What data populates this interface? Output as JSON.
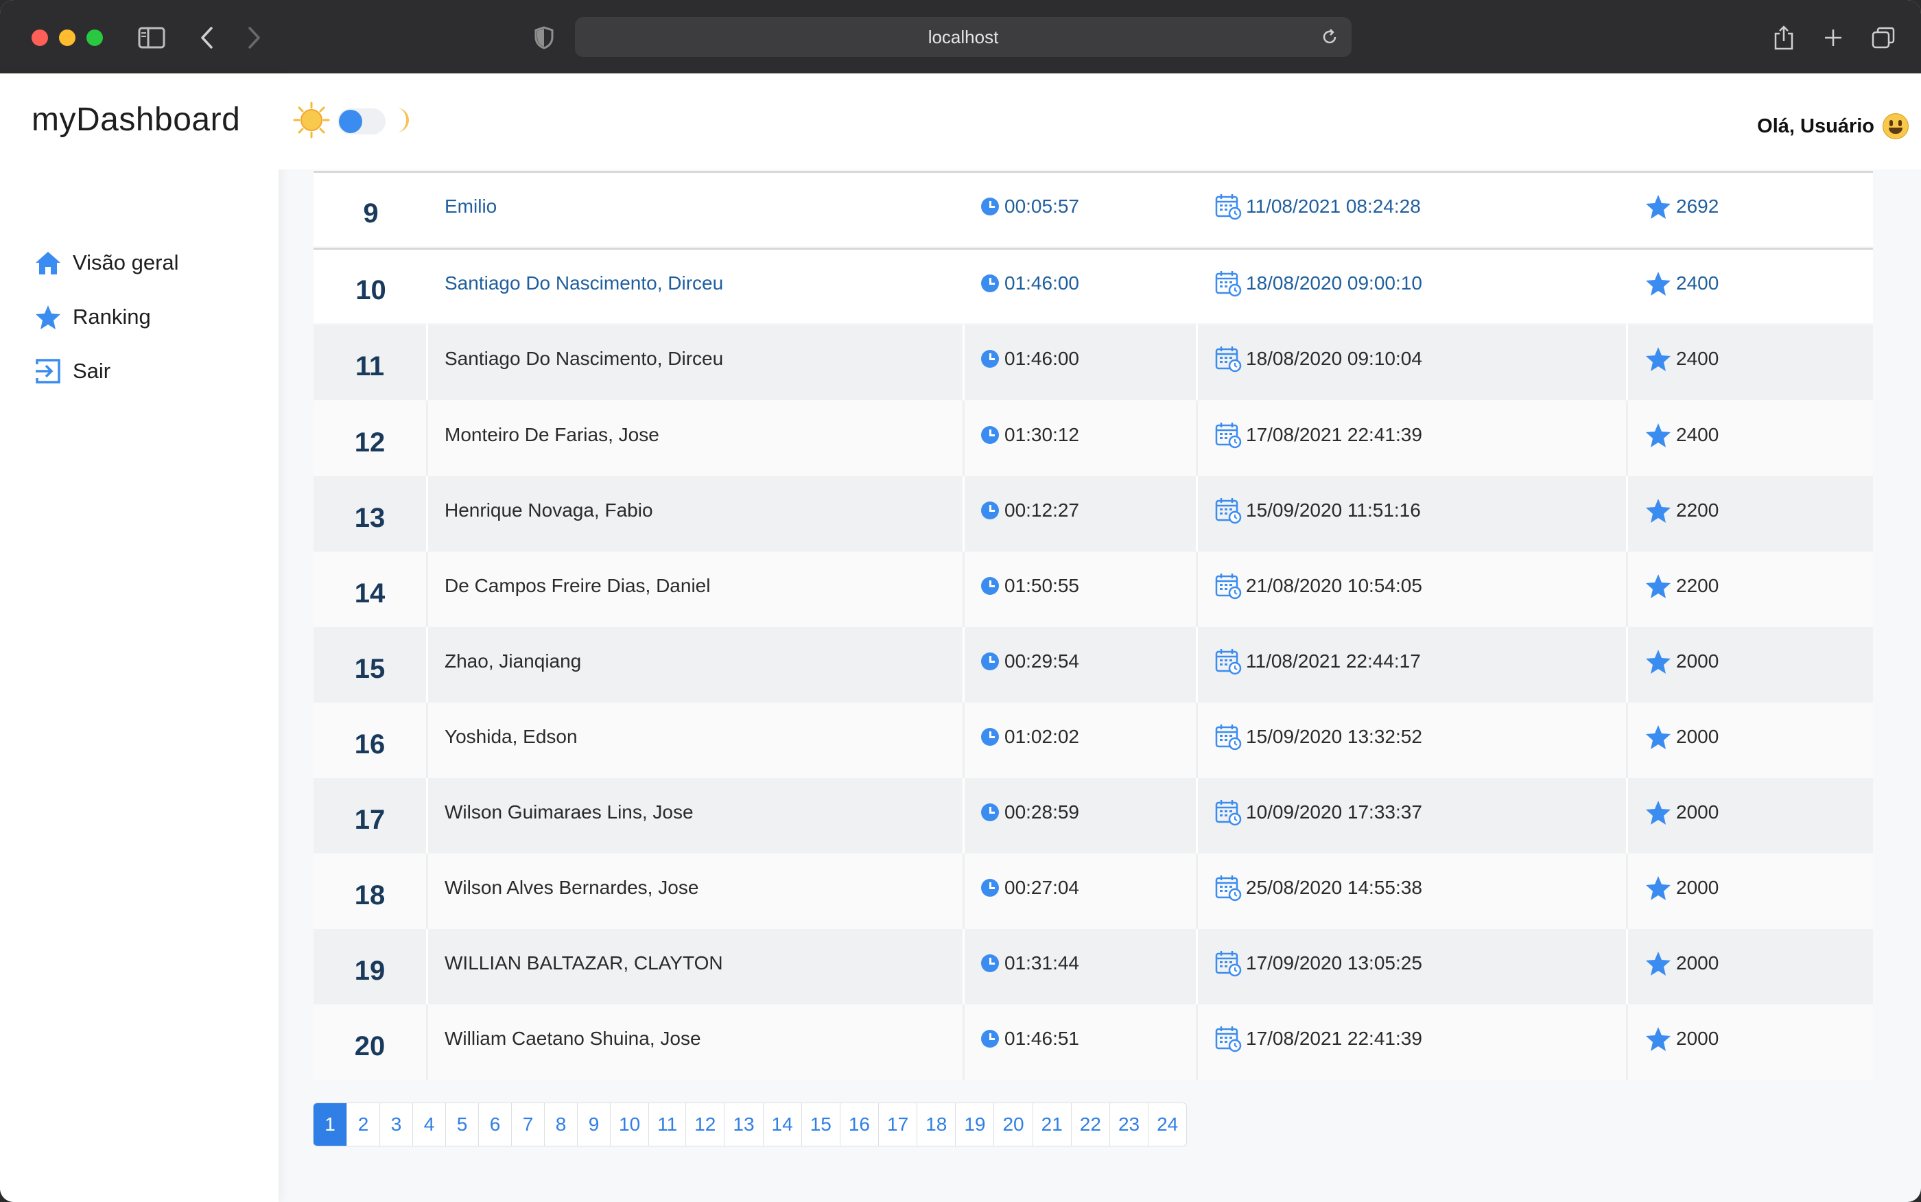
{
  "browser": {
    "url": "localhost"
  },
  "sidebar": {
    "brand": "myDashboard",
    "items": [
      {
        "label": "Visão geral",
        "icon": "home-icon"
      },
      {
        "label": "Ranking",
        "icon": "star-icon"
      },
      {
        "label": "Sair",
        "icon": "sign-out-icon"
      }
    ]
  },
  "header": {
    "greeting": "Olá, Usuário",
    "theme": "light"
  },
  "ranking": {
    "rows": [
      {
        "rank": "9",
        "name": "Emilio",
        "time": "00:05:57",
        "date": "11/08/2021 08:24:28",
        "score": "2692",
        "style": "hl"
      },
      {
        "rank": "10",
        "name": "Santiago Do Nascimento, Dirceu",
        "time": "01:46:00",
        "date": "18/08/2020 09:00:10",
        "score": "2400",
        "style": "hl"
      },
      {
        "rank": "11",
        "name": "Santiago Do Nascimento, Dirceu",
        "time": "01:46:00",
        "date": "18/08/2020 09:10:04",
        "score": "2400",
        "style": "alt"
      },
      {
        "rank": "12",
        "name": "Monteiro De Farias, Jose",
        "time": "01:30:12",
        "date": "17/08/2021 22:41:39",
        "score": "2400",
        "style": "plain"
      },
      {
        "rank": "13",
        "name": "Henrique Novaga, Fabio",
        "time": "00:12:27",
        "date": "15/09/2020 11:51:16",
        "score": "2200",
        "style": "alt"
      },
      {
        "rank": "14",
        "name": "De Campos Freire Dias, Daniel",
        "time": "01:50:55",
        "date": "21/08/2020 10:54:05",
        "score": "2200",
        "style": "plain"
      },
      {
        "rank": "15",
        "name": "Zhao, Jianqiang",
        "time": "00:29:54",
        "date": "11/08/2021 22:44:17",
        "score": "2000",
        "style": "alt"
      },
      {
        "rank": "16",
        "name": "Yoshida, Edson",
        "time": "01:02:02",
        "date": "15/09/2020 13:32:52",
        "score": "2000",
        "style": "plain"
      },
      {
        "rank": "17",
        "name": "Wilson Guimaraes Lins, Jose",
        "time": "00:28:59",
        "date": "10/09/2020 17:33:37",
        "score": "2000",
        "style": "alt"
      },
      {
        "rank": "18",
        "name": "Wilson Alves Bernardes, Jose",
        "time": "00:27:04",
        "date": "25/08/2020 14:55:38",
        "score": "2000",
        "style": "plain"
      },
      {
        "rank": "19",
        "name": "WILLIAN BALTAZAR, CLAYTON",
        "time": "01:31:44",
        "date": "17/09/2020 13:05:25",
        "score": "2000",
        "style": "alt"
      },
      {
        "rank": "20",
        "name": "William Caetano Shuina, Jose",
        "time": "01:46:51",
        "date": "17/08/2021 22:41:39",
        "score": "2000",
        "style": "plain"
      }
    ]
  },
  "pagination": {
    "active": "1",
    "pages": [
      "1",
      "2",
      "3",
      "4",
      "5",
      "6",
      "7",
      "8",
      "9",
      "10",
      "11",
      "12",
      "13",
      "14",
      "15",
      "16",
      "17",
      "18",
      "19",
      "20",
      "21",
      "22",
      "23",
      "24"
    ]
  },
  "colors": {
    "accent": "#2f7fe6",
    "icon_blue": "#3b8cf0",
    "rank_navy": "#193a5c",
    "link_blue": "#1f5f9e"
  }
}
